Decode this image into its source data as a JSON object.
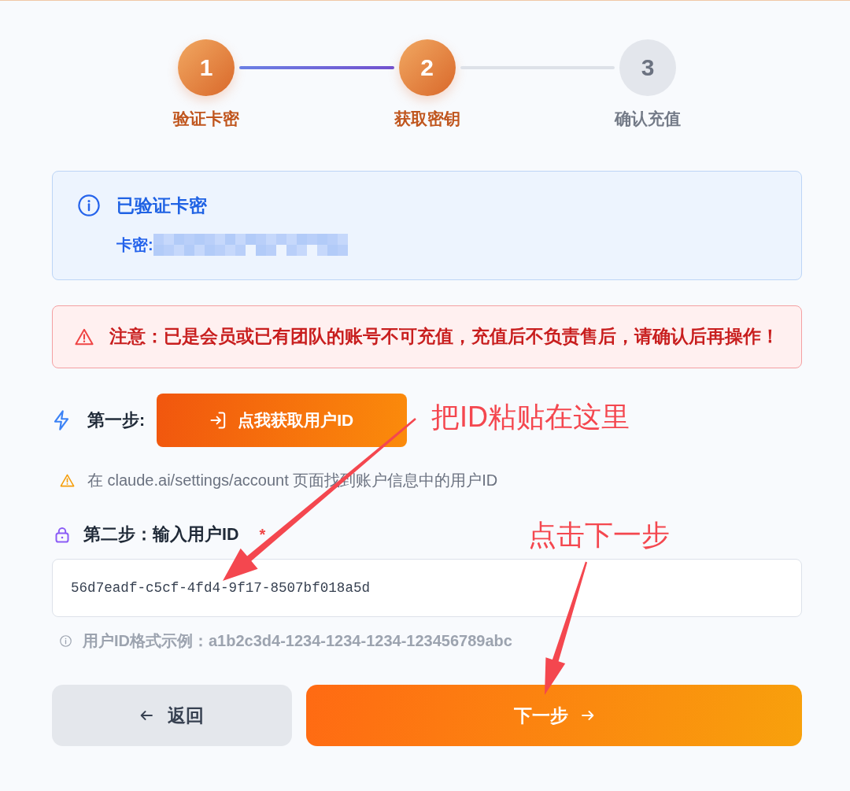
{
  "steps": [
    {
      "number": "1",
      "label": "验证卡密",
      "active": true
    },
    {
      "number": "2",
      "label": "获取密钥",
      "active": true
    },
    {
      "number": "3",
      "label": "确认充值",
      "active": false
    }
  ],
  "verified": {
    "title": "已验证卡密",
    "key_label": "卡密:",
    "key_redacted": true
  },
  "alert": {
    "text": "注意：已是会员或已有团队的账号不可充值，充值后不负责售后，请确认后再操作！"
  },
  "step_one": {
    "label": "第一步:",
    "button": "点我获取用户ID",
    "hint": "在 claude.ai/settings/account 页面找到账户信息中的用户ID"
  },
  "step_two": {
    "label": "第二步：输入用户ID",
    "required_mark": "*",
    "value": "56d7eadf-c5cf-4fd4-9f17-8507bf018a5d",
    "format_hint": "用户ID格式示例：a1b2c3d4-1234-1234-1234-123456789abc"
  },
  "buttons": [
    {
      "kind": "back",
      "label": "返回"
    },
    {
      "kind": "next",
      "label": "下一步"
    }
  ],
  "annotations": [
    {
      "text": "把ID粘贴在这里"
    },
    {
      "text": "点击下一步"
    }
  ]
}
